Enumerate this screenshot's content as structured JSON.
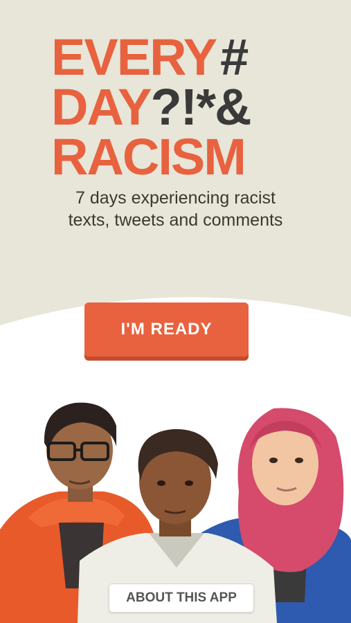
{
  "logo": {
    "line1_word": "EVERY",
    "line1_sym": "#",
    "line2_word": "DAY",
    "line2_sym": "?!*&",
    "line3_word": "RACISM"
  },
  "tagline": {
    "line1": "7 days experiencing racist",
    "line2": "texts, tweets and comments"
  },
  "buttons": {
    "ready": "I'M READY",
    "about": "ABOUT THIS APP"
  },
  "colors": {
    "accent": "#e8623f",
    "background_top": "#e7e6d8",
    "text_dark": "#3a3a3a"
  },
  "illustration": {
    "figures": [
      "man-with-glasses-figure",
      "man-in-white-shirt-figure",
      "woman-in-hijab-figure"
    ]
  }
}
